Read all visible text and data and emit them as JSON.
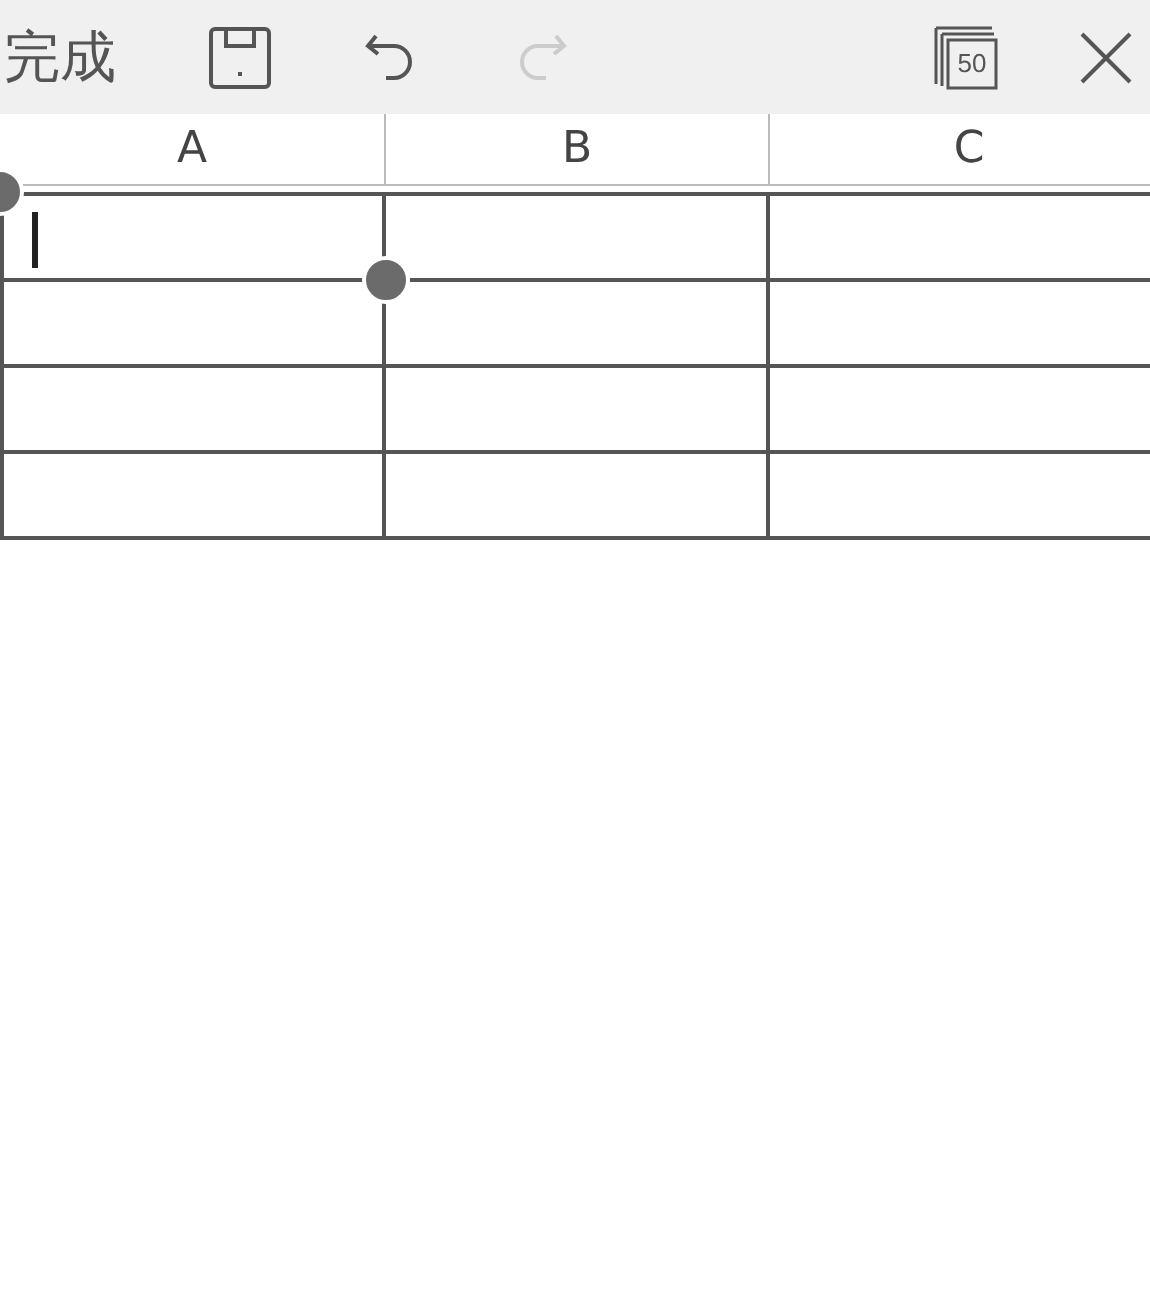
{
  "toolbar": {
    "done": "完成",
    "undo": {
      "disabled": false
    },
    "redo": {
      "disabled": true
    },
    "zoom_badge": "50"
  },
  "table": {
    "columns": [
      "A",
      "B",
      "C"
    ],
    "rows": [
      {
        "cells": [
          {
            "selected": true
          },
          {
            "selected": false
          },
          {
            "selected": false
          }
        ]
      },
      {
        "cells": [
          {
            "selected": false
          },
          {
            "selected": false
          },
          {
            "selected": false
          }
        ]
      },
      {
        "cells": [
          {
            "selected": false
          },
          {
            "selected": false
          },
          {
            "selected": false
          }
        ]
      },
      {
        "cells": [
          {
            "selected": false
          },
          {
            "selected": false
          },
          {
            "selected": false
          }
        ]
      }
    ]
  }
}
